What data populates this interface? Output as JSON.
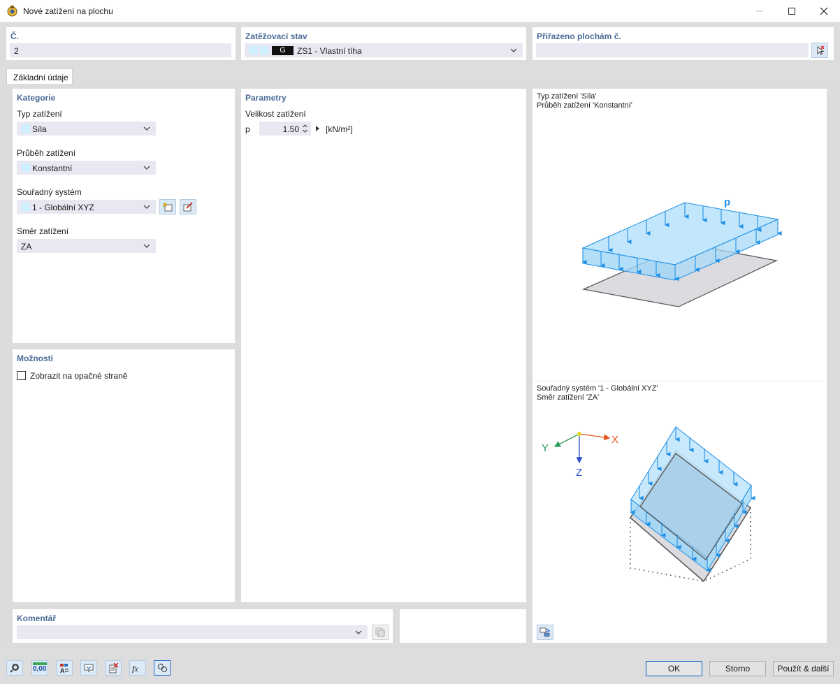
{
  "window": {
    "title": "Nové zatížení na plochu"
  },
  "header": {
    "number_label": "Č.",
    "number_value": "2",
    "load_case_label": "Zatěžovací stav",
    "load_case_badge": "G",
    "load_case_value": "ZS1 - Vlastní tíha",
    "assigned_label": "Přiřazeno plochám č.",
    "assigned_value": ""
  },
  "tabs": [
    {
      "label": "Základní údaje"
    }
  ],
  "category": {
    "title": "Kategorie",
    "load_type_label": "Typ zatížení",
    "load_type_value": "Síla",
    "distribution_label": "Průběh zatížení",
    "distribution_value": "Konstantní",
    "coord_label": "Souřadný systém",
    "coord_value": "1 - Globální XYZ",
    "direction_label": "Směr zatížení",
    "direction_value": "ZA"
  },
  "parameters": {
    "title": "Parametry",
    "magnitude_label": "Velikost zatížení",
    "symbol": "p",
    "value": "1.50",
    "unit": "[kN/m²]"
  },
  "options": {
    "title": "Možnosti",
    "show_opposite_label": "Zobrazit na opačné straně",
    "show_opposite_checked": false
  },
  "comment": {
    "title": "Komentář",
    "value": ""
  },
  "diagram_top": {
    "line1": "Typ zatížení 'Síla'",
    "line2": "Průběh zatížení 'Konstantní'",
    "load_symbol": "p"
  },
  "diagram_bottom": {
    "line1": "Souřadný systém '1 - Globální XYZ'",
    "line2": "Směr zatížení 'ZA'",
    "axis_x": "X",
    "axis_y": "Y",
    "axis_z": "Z"
  },
  "toolbar_icons": [
    "search-icon",
    "number-format-icon",
    "text-style-icon",
    "view-icon",
    "delete-icon",
    "formula-icon",
    "settings-icon"
  ],
  "toolbar_number_text": "0,00",
  "buttons": {
    "ok": "OK",
    "cancel": "Storno",
    "apply_next": "Použít & další"
  },
  "colors": {
    "label_blue": "#4a6a96",
    "load_blue": "#1e90e6",
    "load_fill": "#b9e3fb",
    "surface_grey": "#d8d8dc",
    "accent_primary": "#0b62c3"
  }
}
